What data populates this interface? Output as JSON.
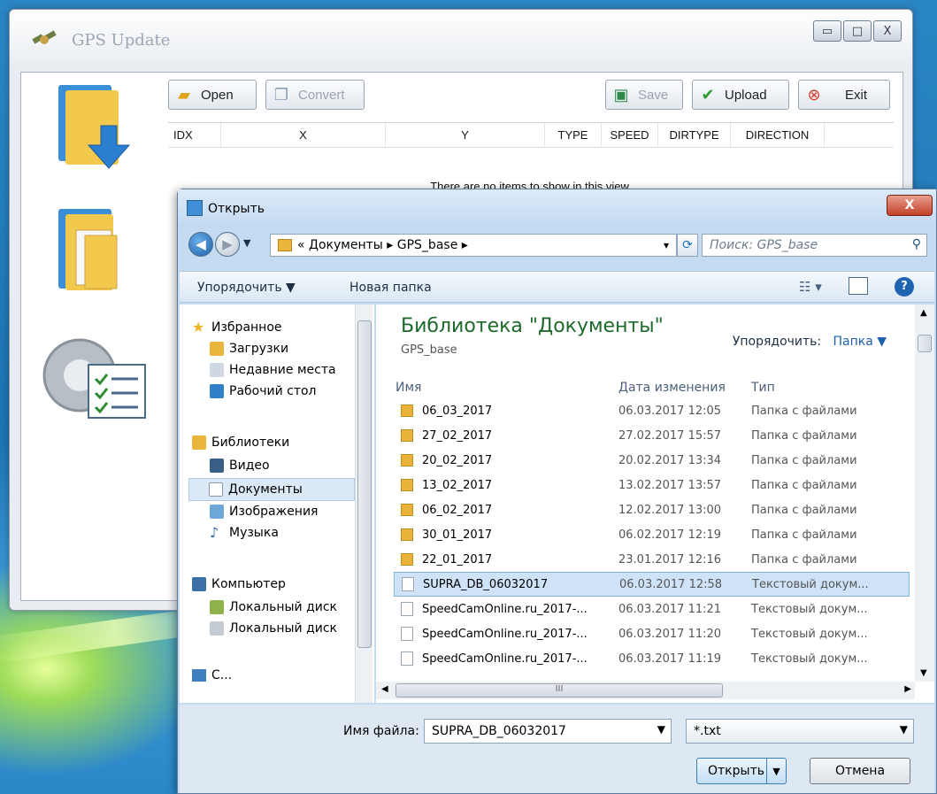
{
  "gps_window": {
    "title": "GPS Update",
    "window_buttons": {
      "minimize": "▭",
      "maximize": "□",
      "close": "X"
    },
    "toolbar": {
      "open": "Open",
      "convert": "Convert",
      "save": "Save",
      "upload": "Upload",
      "exit": "Exit"
    },
    "columns": [
      "IDX",
      "X",
      "Y",
      "TYPE",
      "SPEED",
      "DIRTYPE",
      "DIRECTION"
    ],
    "empty_text": "There are no items to show in this view."
  },
  "dialog": {
    "title": "Открыть",
    "close": "X",
    "address": {
      "prefix": "«",
      "segment1": "Документы",
      "sep1": "▸",
      "segment2": "GPS_base",
      "sep2": "▸",
      "dropdown": "▾"
    },
    "search_placeholder": "Поиск: GPS_base",
    "commands": {
      "organize": "Упорядочить ▼",
      "new_folder": "Новая папка"
    },
    "nav": {
      "favorites": "Избранное",
      "downloads": "Загрузки",
      "recent": "Недавние места",
      "desktop": "Рабочий стол",
      "libraries": "Библиотеки",
      "video": "Видео",
      "documents": "Документы",
      "images": "Изображения",
      "music": "Музыка",
      "computer": "Компьютер",
      "disk1": "Локальный диск",
      "disk2": "Локальный диск",
      "network": "С..."
    },
    "library": {
      "title": "Библиотека \"Документы\"",
      "subtitle": "GPS_base",
      "arrange_label": "Упорядочить:",
      "arrange_value": "Папка ▼"
    },
    "columns": {
      "name": "Имя",
      "date": "Дата изменения",
      "type": "Тип"
    },
    "files": [
      {
        "name": "06_03_2017",
        "date": "06.03.2017 12:05",
        "type": "Папка с файлами",
        "kind": "folder"
      },
      {
        "name": "27_02_2017",
        "date": "27.02.2017 15:57",
        "type": "Папка с файлами",
        "kind": "folder"
      },
      {
        "name": "20_02_2017",
        "date": "20.02.2017 13:34",
        "type": "Папка с файлами",
        "kind": "folder"
      },
      {
        "name": "13_02_2017",
        "date": "13.02.2017 13:57",
        "type": "Папка с файлами",
        "kind": "folder"
      },
      {
        "name": "06_02_2017",
        "date": "12.02.2017 13:00",
        "type": "Папка с файлами",
        "kind": "folder"
      },
      {
        "name": "30_01_2017",
        "date": "06.02.2017 12:19",
        "type": "Папка с файлами",
        "kind": "folder"
      },
      {
        "name": "22_01_2017",
        "date": "23.01.2017 12:16",
        "type": "Папка с файлами",
        "kind": "folder"
      },
      {
        "name": "SUPRA_DB_06032017",
        "date": "06.03.2017 12:58",
        "type": "Текстовый докум...",
        "kind": "doc",
        "selected": true
      },
      {
        "name": "SpeedCamOnline.ru_2017-...",
        "date": "06.03.2017 11:21",
        "type": "Текстовый докум...",
        "kind": "doc"
      },
      {
        "name": "SpeedCamOnline.ru_2017-...",
        "date": "06.03.2017 11:20",
        "type": "Текстовый докум...",
        "kind": "doc"
      },
      {
        "name": "SpeedCamOnline.ru_2017-...",
        "date": "06.03.2017 11:19",
        "type": "Текстовый докум...",
        "kind": "doc"
      }
    ],
    "filename_label": "Имя файла:",
    "filename_value": "SUPRA_DB_06032017",
    "filetype_value": "*.txt",
    "open_button": "Открыть",
    "cancel_button": "Отмена",
    "hscroll_grip": "III"
  },
  "colors": {
    "accent": "#3c7fb1",
    "library_title": "#1e6a2c",
    "close_red": "#c3402a"
  }
}
